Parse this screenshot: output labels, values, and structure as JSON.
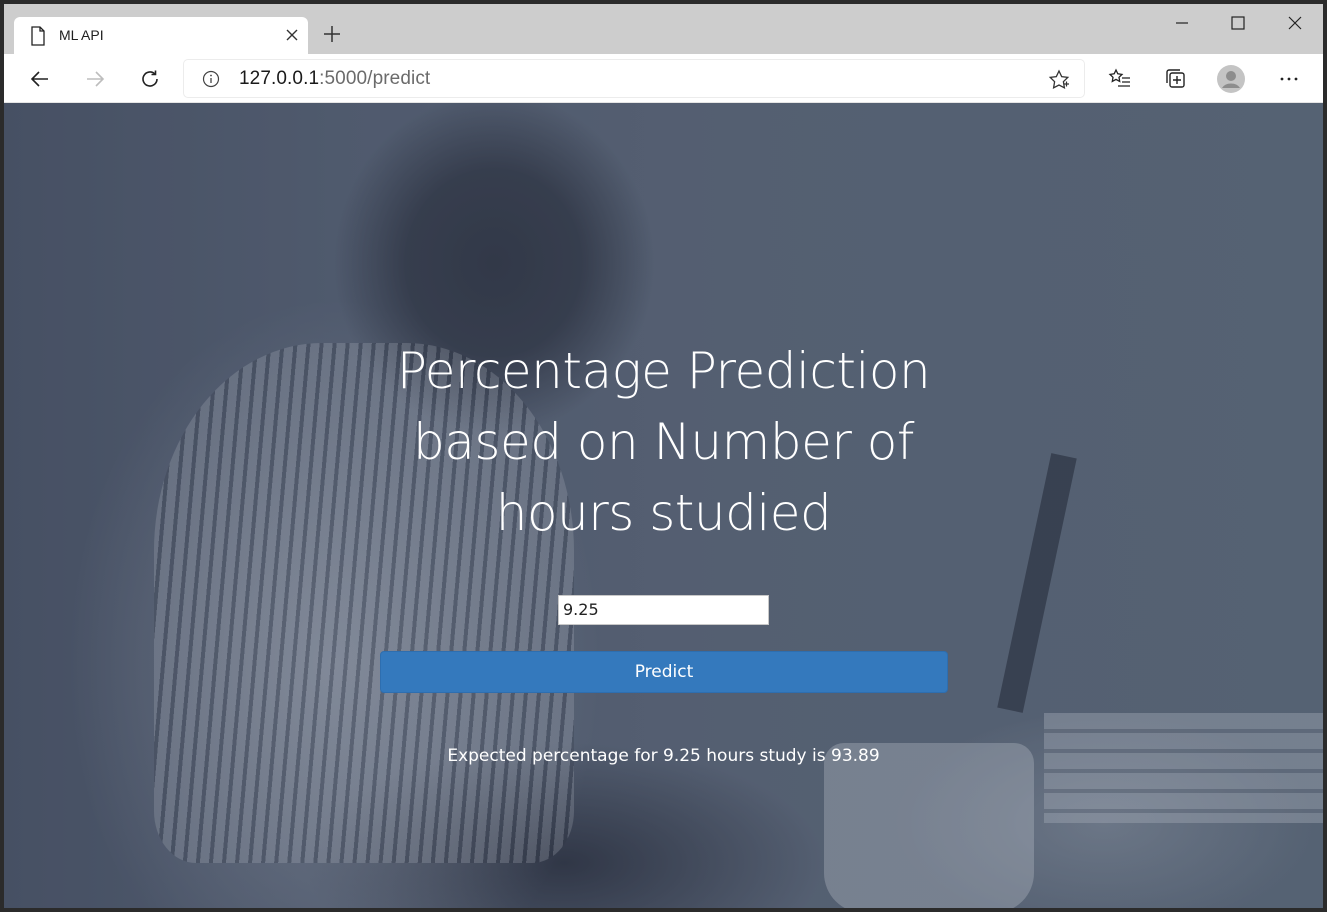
{
  "browser": {
    "tab": {
      "title": "ML API",
      "icon": "page-icon"
    },
    "new_tab_icon": "plus-icon",
    "window_controls": [
      "minimize-icon",
      "maximize-icon",
      "close-icon"
    ],
    "address": {
      "host": "127.0.0.1",
      "path": ":5000/predict"
    },
    "toolbar_icons": [
      "back-icon",
      "forward-icon",
      "refresh-icon",
      "info-icon",
      "favorite-star-icon",
      "favorites-list-icon",
      "collections-icon",
      "profile-avatar",
      "more-menu-icon"
    ]
  },
  "page": {
    "heading_lines": [
      "Percentage Prediction",
      "based on Number of",
      "hours studied"
    ],
    "input_value": "9.25",
    "button_label": "Predict",
    "result_text": "Expected percentage for 9.25 hours study is 93.89"
  },
  "colors": {
    "accent_button": "#3479bd",
    "overlay": "#5a6478"
  }
}
